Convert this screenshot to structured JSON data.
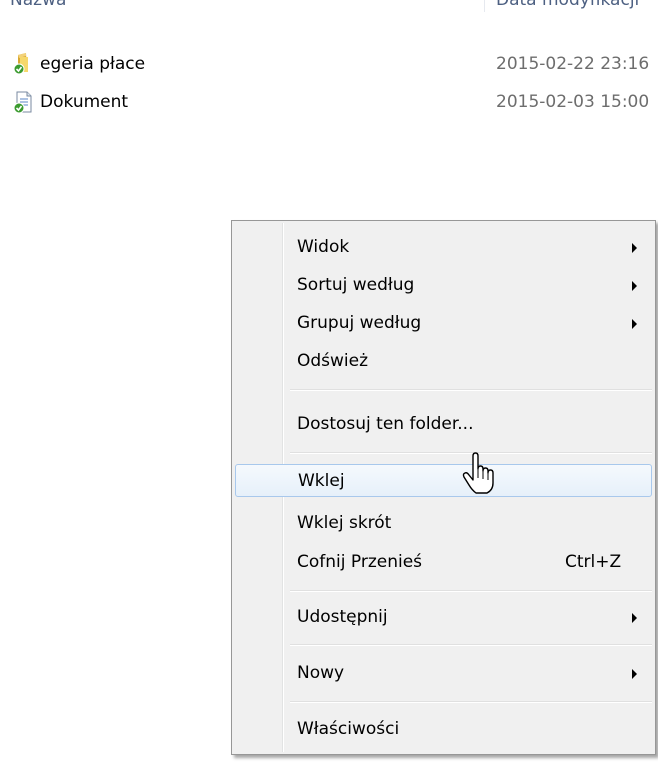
{
  "header": {
    "name_label": "Nazwa",
    "date_label": "Data modyfikacji"
  },
  "files": [
    {
      "name": "egeria płace",
      "date": "2015-02-22 23:16",
      "icon": "folder-icon"
    },
    {
      "name": "Dokument",
      "date": "2015-02-03 15:00",
      "icon": "document-icon"
    }
  ],
  "context_menu": {
    "items": [
      {
        "label": "Widok",
        "submenu": true
      },
      {
        "label": "Sortuj według",
        "submenu": true
      },
      {
        "label": "Grupuj według",
        "submenu": true
      },
      {
        "label": "Odśwież",
        "submenu": false
      },
      {
        "label": "Dostosuj ten folder...",
        "submenu": false
      },
      {
        "label": "Wklej",
        "submenu": false,
        "highlighted": true
      },
      {
        "label": "Wklej skrót",
        "submenu": false
      },
      {
        "label": "Cofnij Przenieś",
        "shortcut": "Ctrl+Z",
        "submenu": false
      },
      {
        "label": "Udostępnij",
        "submenu": true
      },
      {
        "label": "Nowy",
        "submenu": true
      },
      {
        "label": "Właściwości",
        "submenu": false
      }
    ]
  },
  "colors": {
    "menu_bg": "#f0f0f0",
    "highlight_border": "#a8c8ec",
    "date_text": "#6d6d6d"
  }
}
